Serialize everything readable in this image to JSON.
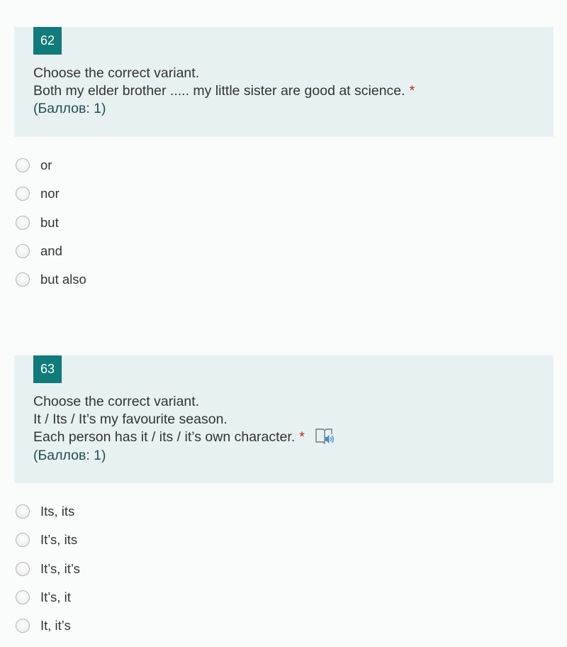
{
  "questions": [
    {
      "number": "62",
      "lines": [
        "Choose the correct variant.",
        "Both my elder brother ..... my little sister are good at science."
      ],
      "required_mark": "*",
      "points": "(Баллов: 1)",
      "options": [
        "or",
        "nor",
        "but",
        "and",
        "but also"
      ]
    },
    {
      "number": "63",
      "lines": [
        "Choose the correct variant.",
        "It / Its / It’s my favourite season.",
        "Each person has it / its / it’s own character."
      ],
      "required_mark": "*",
      "points": "(Баллов: 1)",
      "audio_icon": "immersive-reader-icon",
      "options": [
        "Its, its",
        "It’s, its",
        "It’s, it’s",
        "It’s, it",
        "It, it’s"
      ]
    }
  ],
  "colors": {
    "card_bg": "#e8f1f2",
    "number_badge": "#0f7b7a",
    "required": "#c0281e",
    "points_text": "#1d4f4f",
    "icon_blue": "#3a8fc9"
  }
}
